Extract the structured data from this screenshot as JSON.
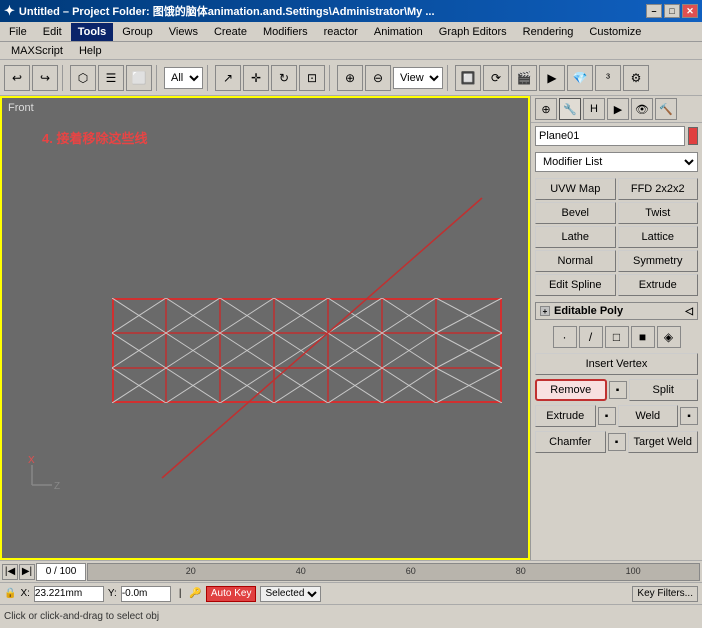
{
  "titlebar": {
    "title": "Untitled  – Project Folder: 图饿的脑体animation.and.Settings\\Administrator\\My ...",
    "icon": "✦",
    "minimize_label": "–",
    "maximize_label": "□",
    "close_label": "✕"
  },
  "menubar": {
    "items": [
      {
        "label": "File"
      },
      {
        "label": "Edit"
      },
      {
        "label": "Tools",
        "active": true
      },
      {
        "label": "Group"
      },
      {
        "label": "Views"
      },
      {
        "label": "Create"
      },
      {
        "label": "Modifiers"
      },
      {
        "label": "reactor"
      },
      {
        "label": "Animation"
      },
      {
        "label": "Graph Editors"
      },
      {
        "label": "Rendering"
      },
      {
        "label": "Customize"
      }
    ]
  },
  "maxscript_bar": {
    "items": [
      {
        "label": "MAXScript"
      },
      {
        "label": "Help"
      }
    ]
  },
  "toolbar": {
    "filter_label": "All",
    "view_label": "View"
  },
  "viewport": {
    "label": "Front",
    "annotation": "4. 接着移除这些线"
  },
  "trackbar": {
    "current_frame": "0 / 100",
    "ticks": [
      "20",
      "40",
      "60",
      "80",
      "100"
    ]
  },
  "rightpanel": {
    "object_name": "Plane01",
    "modifier_list_label": "Modifier List",
    "modifiers": [
      {
        "label": "UVW Map"
      },
      {
        "label": "FFD 2x2x2"
      },
      {
        "label": "Bevel"
      },
      {
        "label": "Twist"
      },
      {
        "label": "Lathe"
      },
      {
        "label": "Lattice"
      },
      {
        "label": "Normal"
      },
      {
        "label": "Symmetry"
      },
      {
        "label": "Edit Spline"
      },
      {
        "label": "Extrude"
      }
    ],
    "editable_poly_label": "Editable Poly",
    "subobj_icons": [
      "▼",
      "△",
      "◇",
      "■",
      "◯"
    ],
    "section_buttons": [
      {
        "label": "Insert Vertex"
      },
      {
        "label": "Remove"
      },
      {
        "label": "Split"
      },
      {
        "label": "Extrude"
      },
      {
        "label": "Weld"
      },
      {
        "label": "Chamfer"
      },
      {
        "label": "Target Weld"
      }
    ]
  },
  "statusbar": {
    "text": "Click or click-and-drag to select obj"
  },
  "bottombar": {
    "lock_icon": "🔒",
    "x_label": "X:",
    "x_value": "23.221mm",
    "y_label": "Y:",
    "y_value": "-0.0m",
    "autokey_label": "Auto Key",
    "selected_label": "Selected",
    "key_filters_label": "Key Filters..."
  }
}
